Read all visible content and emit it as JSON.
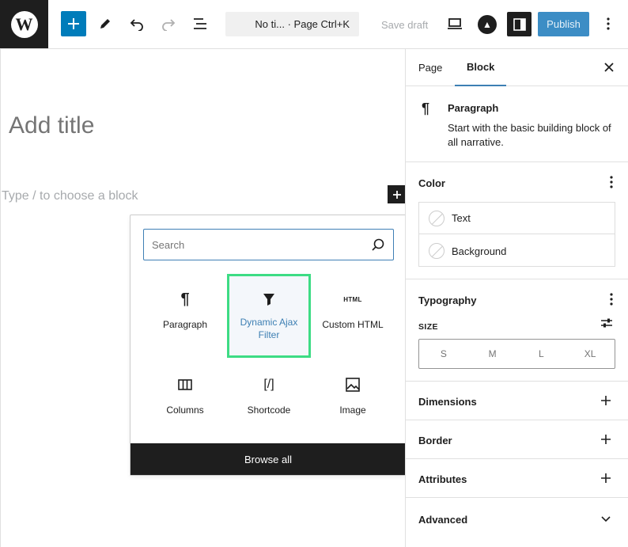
{
  "toolbar": {
    "command_text": "No ti... · Page Ctrl+K",
    "save_draft": "Save draft",
    "publish": "Publish"
  },
  "editor": {
    "title_placeholder": "Add title",
    "block_placeholder": "Type / to choose a block"
  },
  "inserter": {
    "search_placeholder": "Search",
    "blocks": [
      {
        "label": "Paragraph",
        "icon": "paragraph-icon"
      },
      {
        "label": "Dynamic Ajax Filter",
        "icon": "filter-icon"
      },
      {
        "label": "Custom HTML",
        "icon": "html-icon"
      },
      {
        "label": "Columns",
        "icon": "columns-icon"
      },
      {
        "label": "Shortcode",
        "icon": "shortcode-icon"
      },
      {
        "label": "Image",
        "icon": "image-icon"
      }
    ],
    "html_icon_text": "HTML",
    "shortcode_icon_text": "[/]",
    "browse_all": "Browse all"
  },
  "sidebar": {
    "tabs": [
      "Page",
      "Block"
    ],
    "active_tab": "Block",
    "block": {
      "icon_glyph": "¶",
      "name": "Paragraph",
      "description": "Start with the basic building block of all narrative."
    },
    "color": {
      "title": "Color",
      "items": [
        "Text",
        "Background"
      ]
    },
    "typography": {
      "title": "Typography",
      "size_label": "SIZE",
      "sizes": [
        "S",
        "M",
        "L",
        "XL"
      ]
    },
    "panels": [
      "Dimensions",
      "Border",
      "Attributes",
      "Advanced"
    ]
  },
  "colors": {
    "accent": "#007cba",
    "publish_bg": "#3c8dc5",
    "selected_border": "#3ddc84",
    "dark": "#1e1e1e"
  }
}
